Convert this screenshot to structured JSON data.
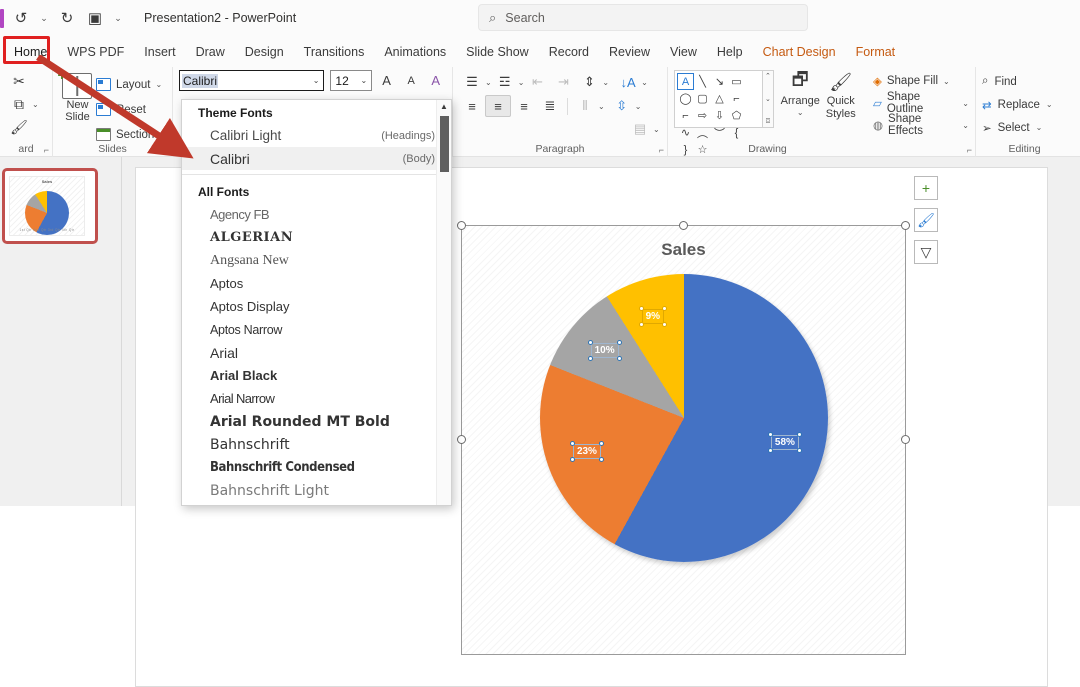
{
  "app": {
    "title": "Presentation2  -  PowerPoint",
    "quick_access": [
      {
        "name": "undo-icon",
        "glyph": "↺"
      },
      {
        "name": "undo-dropdown-icon",
        "glyph": "⌄"
      },
      {
        "name": "redo-icon",
        "glyph": "↻"
      },
      {
        "name": "present-icon",
        "glyph": "▣"
      },
      {
        "name": "customize-qat-icon",
        "glyph": "⌄"
      }
    ]
  },
  "search": {
    "icon": "⌕",
    "placeholder": "Search"
  },
  "tabs": [
    {
      "label": "Home",
      "state": "active"
    },
    {
      "label": "WPS PDF",
      "state": "normal"
    },
    {
      "label": "Insert",
      "state": "normal"
    },
    {
      "label": "Draw",
      "state": "normal"
    },
    {
      "label": "Design",
      "state": "normal"
    },
    {
      "label": "Transitions",
      "state": "normal"
    },
    {
      "label": "Animations",
      "state": "normal"
    },
    {
      "label": "Slide Show",
      "state": "normal"
    },
    {
      "label": "Record",
      "state": "normal"
    },
    {
      "label": "Review",
      "state": "normal"
    },
    {
      "label": "View",
      "state": "normal"
    },
    {
      "label": "Help",
      "state": "normal"
    },
    {
      "label": "Chart Design",
      "state": "contextual"
    },
    {
      "label": "Format",
      "state": "contextual"
    }
  ],
  "ribbon": {
    "clipboard": {
      "label": "ard",
      "cut": "✂",
      "copy": "⧉",
      "copy_caret": "⌄",
      "format_painter": "🖌",
      "dialog_launcher": "⌐"
    },
    "slides": {
      "label": "Slides",
      "new_slide": "New Slide ⌄",
      "new_slide_line1": "New",
      "new_slide_line2": "Slide",
      "layout": "Layout",
      "reset": "Reset",
      "section": "Section"
    },
    "font": {
      "font_name_value": "Calibri",
      "font_size_value": "12",
      "increase_font": "A",
      "decrease_font": "A",
      "clear_formatting": "A"
    },
    "paragraph": {
      "label": "Paragraph",
      "dialog_launcher": "⌐",
      "buttons": [
        "bullets",
        "numbering",
        "decrease-indent",
        "increase-indent",
        "line-spacing",
        "align-left",
        "align-center",
        "align-right",
        "justify",
        "columns",
        "text-direction",
        "align-text",
        "convert-to-smartart"
      ]
    },
    "drawing": {
      "label": "Drawing",
      "arrange": "Arrange",
      "quick_styles_line1": "Quick",
      "quick_styles_line2": "Styles",
      "shape_fill": "Shape Fill",
      "shape_outline": "Shape Outline",
      "shape_effects": "Shape Effects",
      "dialog_launcher": "⌐",
      "shapes": [
        "A",
        "╲",
        "↘",
        "▭",
        "◯",
        "▢",
        "△",
        "⌐",
        "⌐",
        "⇨",
        "⇩",
        "⬠",
        "∾",
        "︵",
        "︶",
        "{",
        "}",
        "☆"
      ]
    },
    "editing": {
      "label": "Editing",
      "find": "Find",
      "replace": "Replace",
      "select": "Select"
    }
  },
  "font_dropdown": {
    "theme_fonts_header": "Theme Fonts",
    "all_fonts_header": "All Fonts",
    "theme_fonts": [
      {
        "name": "Calibri Light",
        "hint": "(Headings)",
        "style": "f-calibrilight",
        "selected": false
      },
      {
        "name": "Calibri",
        "hint": "(Body)",
        "style": "f-calibri",
        "selected": true
      }
    ],
    "all_fonts": [
      {
        "name": "Agency FB",
        "style": "f-agency"
      },
      {
        "name": "ALGERIAN",
        "style": "f-algerian"
      },
      {
        "name": "Angsana New",
        "style": "f-angsana"
      },
      {
        "name": "Aptos",
        "style": "f-aptos"
      },
      {
        "name": "Aptos Display",
        "style": "f-aptos"
      },
      {
        "name": "Aptos Narrow",
        "style": "f-aptosnarrow"
      },
      {
        "name": "Arial",
        "style": "f-arial"
      },
      {
        "name": "Arial Black",
        "style": "f-arialblack"
      },
      {
        "name": "Arial Narrow",
        "style": "f-arialnarrow"
      },
      {
        "name": "Arial Rounded MT Bold",
        "style": "f-arialrounded"
      },
      {
        "name": "Bahnschrift",
        "style": "f-bahn"
      },
      {
        "name": "Bahnschrift Condensed",
        "style": "f-bahncond"
      },
      {
        "name": "Bahnschrift Light",
        "style": "f-bahnlight"
      }
    ]
  },
  "thumbnail": {
    "number": "",
    "chart_title": "Sales",
    "legend": "1st Qtr  2nd Qtr  3rd Qtr  4th Qtr"
  },
  "chart_side_buttons": [
    {
      "name": "chart-elements-button",
      "glyph": "+"
    },
    {
      "name": "chart-styles-button",
      "glyph": "🖌"
    },
    {
      "name": "chart-filters-button",
      "glyph": "▽"
    }
  ],
  "chart_data": {
    "type": "pie",
    "title": "Sales",
    "categories": [
      "1st Qtr",
      "2nd Qtr",
      "3rd Qtr",
      "4th Qtr"
    ],
    "values": [
      58,
      23,
      10,
      9
    ],
    "labels": [
      "58%",
      "23%",
      "10%",
      "9%"
    ],
    "colors": [
      "#4472C4",
      "#ED7D31",
      "#A5A5A5",
      "#FFC000"
    ],
    "label_format": "percentage",
    "legend_position": "bottom",
    "selected_element": "data-labels"
  }
}
